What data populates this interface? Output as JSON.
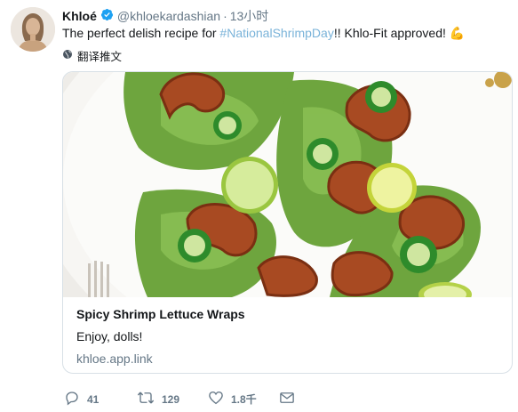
{
  "tweet": {
    "author_name": "Khloé",
    "handle": "@khloekardashian",
    "separator": "·",
    "time": "13小时",
    "text_before": "The perfect delish recipe for ",
    "hashtag": "#NationalShrimpDay",
    "text_after": "!! Khlo-Fit approved! 💪",
    "translate_label": "翻译推文"
  },
  "card": {
    "title": "Spicy Shrimp Lettuce Wraps",
    "description": "Enjoy, dolls!",
    "link": "khloe.app.link"
  },
  "actions": {
    "reply_count": "41",
    "retweet_count": "129",
    "like_count": "1.8千"
  },
  "colors": {
    "accent": "#1da1f2",
    "hashtag": "#7ab3d9",
    "muted": "#657786"
  },
  "icons": [
    "verified-badge-icon",
    "globe-icon",
    "reply-icon",
    "retweet-icon",
    "heart-icon",
    "envelope-icon"
  ]
}
